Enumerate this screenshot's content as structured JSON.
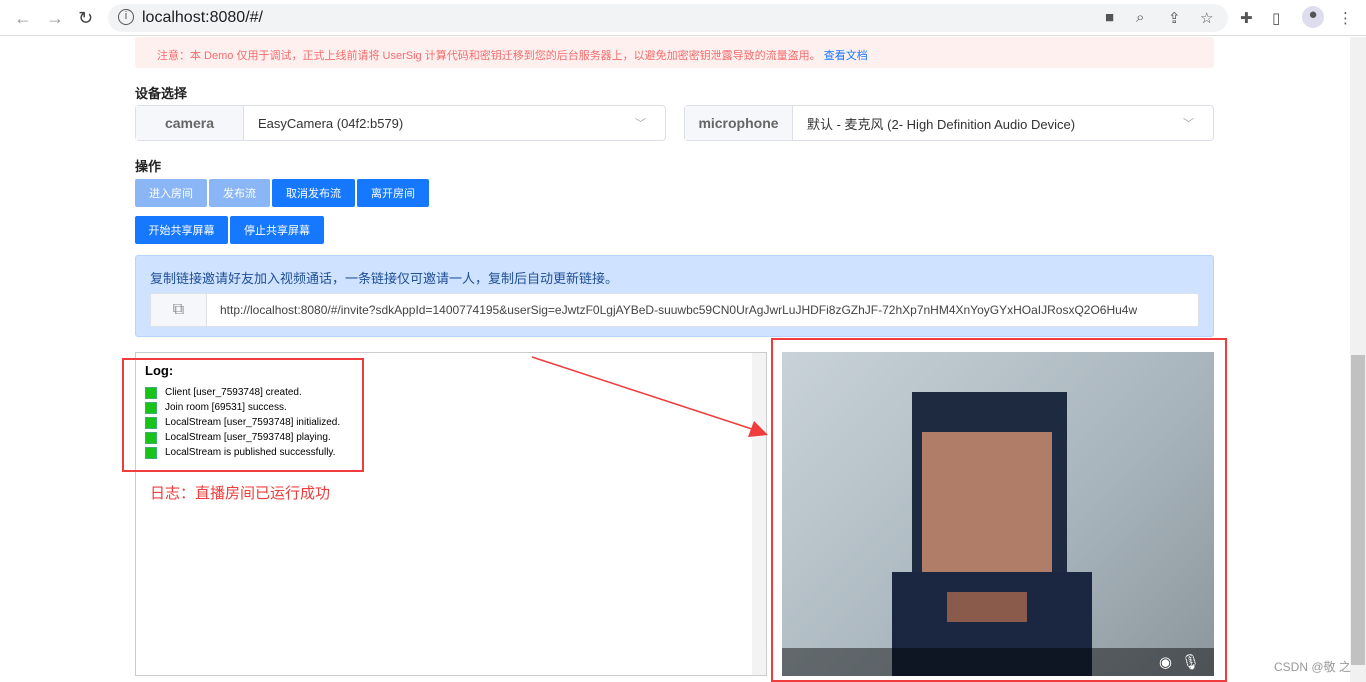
{
  "browser": {
    "url": "localhost:8080/#/",
    "icons": [
      "back-icon",
      "forward-icon",
      "reload-icon",
      "info-icon",
      "camera-icon",
      "zoom-icon",
      "share-icon",
      "star-icon",
      "extensions-icon",
      "sidepanel-icon",
      "profile-icon",
      "menu-icon"
    ]
  },
  "notice": {
    "text": "注意：本 Demo 仅用于调试，正式上线前请将 UserSig 计算代码和密钥迁移到您的后台服务器上，以避免加密密钥泄露导致的流量盗用。",
    "link": "查看文档"
  },
  "devices": {
    "heading": "设备选择",
    "camera_label": "camera",
    "camera_value": "EasyCamera (04f2:b579)",
    "mic_label": "microphone",
    "mic_value": "默认 - 麦克风 (2- High Definition Audio Device)"
  },
  "ops": {
    "heading": "操作",
    "join": "进入房间",
    "publish": "发布流",
    "unpublish": "取消发布流",
    "leave": "离开房间",
    "share_start": "开始共享屏幕",
    "share_stop": "停止共享屏幕"
  },
  "invite": {
    "text": "复制链接邀请好友加入视频通话，一条链接仅可邀请一人，复制后自动更新链接。",
    "link": "http://localhost:8080/#/invite?sdkAppId=1400774195&userSig=eJwtzF0LgjAYBeD-suuwbc59CN0UrAgJwrLuJHDFi8zGZhJF-72hXp7nHM4XnYoyGYxHOaIJRosxQ2O6Hu4w"
  },
  "log": {
    "title": "Log:",
    "entries": [
      "Client [user_7593748] created.",
      "Join room [69531] success.",
      "LocalStream [user_7593748] initialized.",
      "LocalStream [user_7593748] playing.",
      "LocalStream is published successfully."
    ],
    "status_color": "#17c417"
  },
  "annotation": "日志：直播房间已运行成功",
  "watermark": "CSDN @敬 之",
  "colors": {
    "primary": "#1677ff",
    "annotation": "#f03c3c",
    "notice": "#f56c6c"
  }
}
